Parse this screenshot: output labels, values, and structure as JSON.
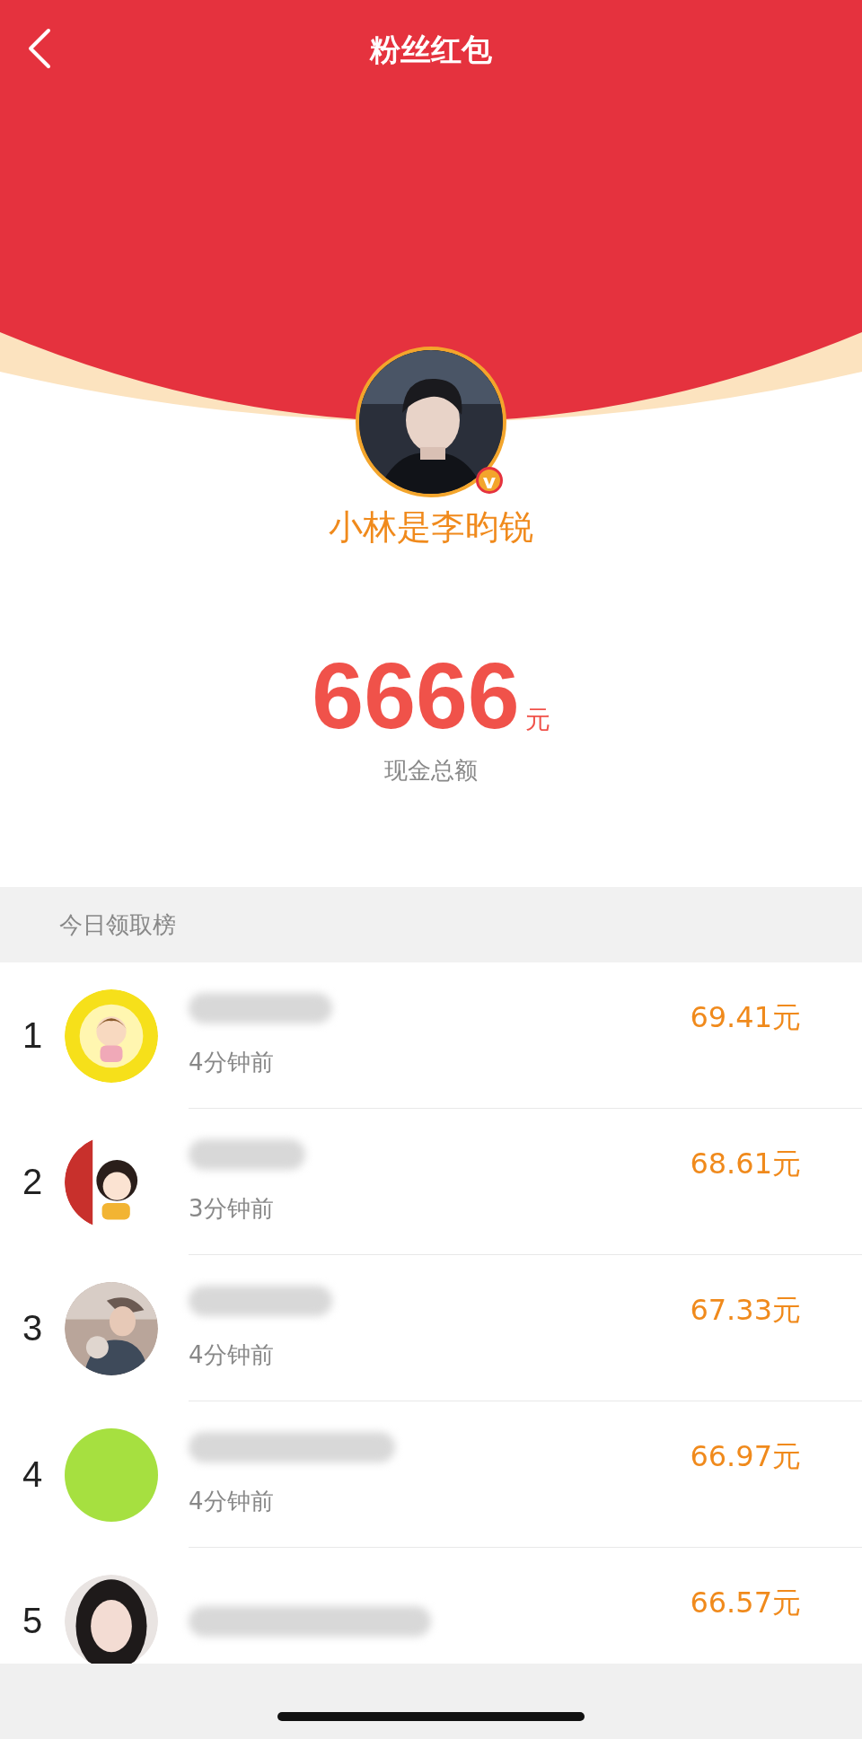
{
  "header": {
    "title": "粉丝红包"
  },
  "creator": {
    "name": "小林是李昀锐",
    "verified_badge": "v"
  },
  "total": {
    "amount": "6666",
    "unit": "元",
    "label": "现金总额"
  },
  "ranking": {
    "title": "今日领取榜",
    "rows": [
      {
        "rank": "1",
        "amount": "69.41元",
        "time": "4分钟前",
        "avatar": {
          "kind": "cartoon-yellow"
        }
      },
      {
        "rank": "2",
        "amount": "68.61元",
        "time": "3分钟前",
        "avatar": {
          "kind": "cartoon-girl"
        }
      },
      {
        "rank": "3",
        "amount": "67.33元",
        "time": "4分钟前"
      },
      {
        "rank": "4",
        "amount": "66.97元",
        "time": "4分钟前",
        "avatar": {
          "kind": "plain"
        }
      },
      {
        "rank": "5",
        "amount": "66.57元",
        "avatar": {
          "kind": "photo-portrait"
        }
      }
    ]
  }
}
